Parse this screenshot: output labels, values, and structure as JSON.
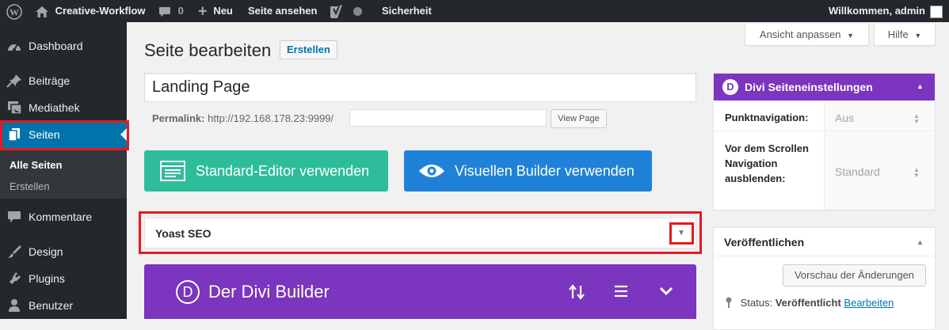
{
  "adminbar": {
    "site_name": "Creative-Workflow",
    "comments_count": "0",
    "new_label": "Neu",
    "view_page": "Seite ansehen",
    "security": "Sicherheit",
    "welcome": "Willkommen, admin"
  },
  "sidebar": {
    "dashboard": "Dashboard",
    "posts": "Beiträge",
    "media": "Mediathek",
    "pages": "Seiten",
    "sub_all_pages": "Alle Seiten",
    "sub_create": "Erstellen",
    "comments": "Kommentare",
    "design": "Design",
    "plugins": "Plugins",
    "users": "Benutzer"
  },
  "screen_options": "Ansicht anpassen",
  "help": "Hilfe",
  "page": {
    "heading": "Seite bearbeiten",
    "add_new": "Erstellen",
    "title_value": "Landing Page",
    "permalink_label": "Permalink:",
    "permalink_base": "http://192.168.178.23:9999/",
    "permalink_slug": "",
    "view_page_btn": "View Page"
  },
  "builder_buttons": {
    "standard": "Standard-Editor verwenden",
    "visual": "Visuellen Builder verwenden"
  },
  "yoast": {
    "title": "Yoast SEO"
  },
  "divi_builder": {
    "logo_letter": "D",
    "title": "Der Divi Builder"
  },
  "divi_settings": {
    "logo_letter": "D",
    "title": "Divi Seiteneinstellungen",
    "dot_nav_label": "Punktnavigation:",
    "dot_nav_value": "Aus",
    "hide_nav_label": "Vor dem Scrollen Navigation ausblenden:",
    "hide_nav_value": "Standard"
  },
  "publish": {
    "title": "Veröffentlichen",
    "preview_btn": "Vorschau der Änderungen",
    "status_label": "Status:",
    "status_value": "Veröffentlicht",
    "edit_link": "Bearbeiten"
  },
  "colors": {
    "adminbar": "#23282d",
    "active_menu": "#0073aa",
    "green_button": "#2ebd9a",
    "blue_button": "#1f82d8",
    "divi_purple": "#7b35be",
    "highlight_red": "#e5191f"
  }
}
